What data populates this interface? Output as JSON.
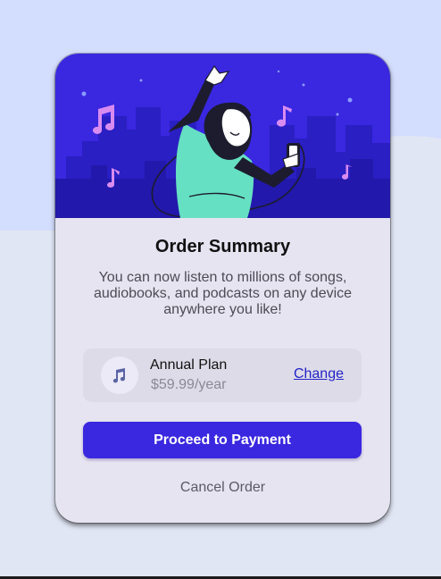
{
  "colors": {
    "page_background": "#e1e6f5",
    "page_background_top": "#d3ddfd",
    "card_background": "#e6e4f0",
    "accent": "#3a27e0",
    "link": "#2323c8"
  },
  "hero": {
    "illustration": "person-dancing-with-headphones-and-phone-over-city-skyline",
    "icons": [
      "music-note-icon"
    ]
  },
  "summary": {
    "title": "Order Summary",
    "description": "You can now listen to millions of songs, audiobooks, and podcasts on any device anywhere you like!"
  },
  "plan": {
    "icon": "music-note-icon",
    "name": "Annual Plan",
    "price": "$59.99/year",
    "change_label": "Change"
  },
  "actions": {
    "proceed_label": "Proceed to Payment",
    "cancel_label": "Cancel Order"
  }
}
